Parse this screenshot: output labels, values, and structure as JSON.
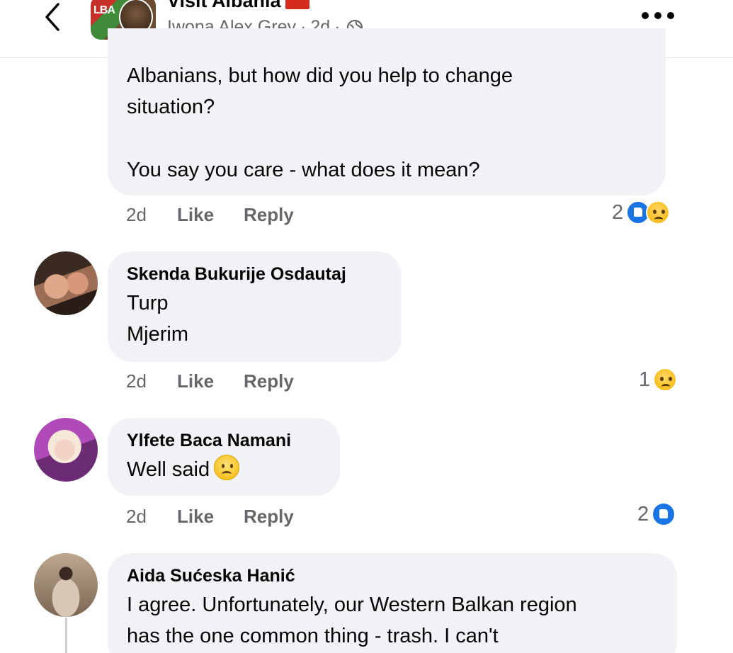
{
  "header": {
    "page_name": "Visit Albania",
    "thumb_text": "LBA",
    "author": "Iwona Alex Grey",
    "separator": "·",
    "age": "2d",
    "back_icon": "chevron-left-icon",
    "privacy_icon": "globe-icon",
    "more_icon": "more-horizontal-icon"
  },
  "comments": [
    {
      "author": "",
      "lines": [
        "Albanians, but how did you help to change",
        "situation?",
        "",
        "You say you care - what does it mean?"
      ],
      "time": "2d",
      "like_label": "Like",
      "reply_label": "Reply",
      "reaction_count": "2",
      "reactions": [
        "like",
        "sad"
      ]
    },
    {
      "author": "Skenda Bukurije Osdautaj",
      "lines": [
        "Turp",
        "Mjerim"
      ],
      "time": "2d",
      "like_label": "Like",
      "reply_label": "Reply",
      "reaction_count": "1",
      "reactions": [
        "sad"
      ]
    },
    {
      "author": "Ylfete Baca Namani",
      "lines": [
        "Well said"
      ],
      "emoji": "frown-emoji",
      "time": "2d",
      "like_label": "Like",
      "reply_label": "Reply",
      "reaction_count": "2",
      "reactions": [
        "like"
      ]
    },
    {
      "author": "Aida Sućeska Hanić",
      "lines": [
        "I agree. Unfortunately, our Western Balkan region",
        "has the one common thing - trash. I can't"
      ]
    }
  ],
  "colors": {
    "bubble": "#f0f2f5",
    "secondary_text": "#65676b",
    "like_blue": "#1b74e4",
    "sad_yellow": "#f4b400"
  }
}
